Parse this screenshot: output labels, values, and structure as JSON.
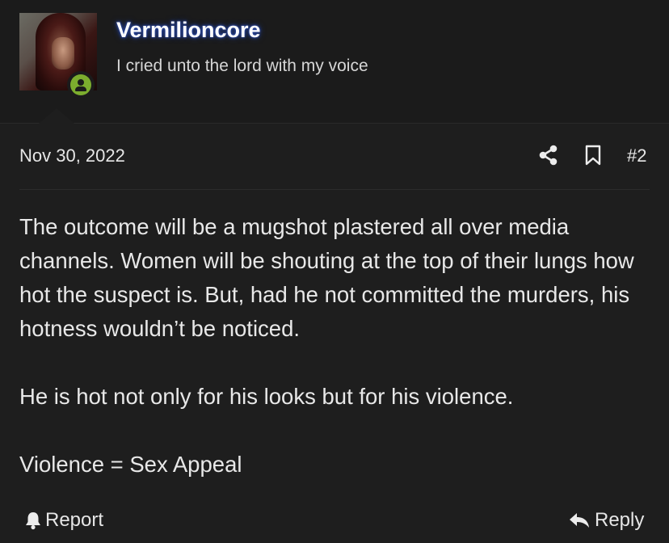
{
  "user": {
    "name": "Vermilioncore",
    "title": "I cried unto the lord with my voice",
    "status": "online"
  },
  "post": {
    "date": "Nov 30, 2022",
    "number": "#2",
    "paragraphs": [
      "The outcome will be a mugshot plastered all over media channels. Women will be shouting at the top of their lungs how hot the suspect is. But, had he not committed the murders, his hotness wouldn’t be noticed.",
      "He is hot not only for his looks but for his violence.",
      "Violence = Sex Appeal"
    ]
  },
  "actions": {
    "share_icon": "share-icon",
    "bookmark_icon": "bookmark-icon",
    "report_label": "Report",
    "reply_label": "Reply"
  },
  "colors": {
    "background": "#1e1e1e",
    "header_background": "#1b1b1b",
    "online_status": "#7cad2e",
    "username_glow": "#2b4aa8"
  }
}
